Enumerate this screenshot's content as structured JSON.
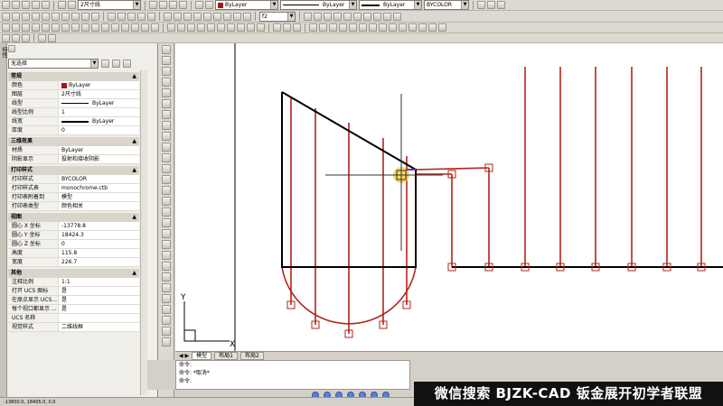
{
  "toolbar": {
    "layer_combo": "ByLayer",
    "linetype_combo": "ByLayer",
    "lineweight_combo": "ByLayer",
    "plotstyle_combo": "BYCOLOR",
    "textstyle_combo": "2尺寸线",
    "dimstyle_combo": "f2"
  },
  "palette": {
    "title": "特性",
    "selection": "无选择",
    "groups": [
      {
        "name": "常规",
        "rows": [
          {
            "k": "颜色",
            "v": "ByLayer",
            "kind": "swatch"
          },
          {
            "k": "图层",
            "v": "2尺寸线"
          },
          {
            "k": "线型",
            "v": "ByLayer",
            "kind": "thin"
          },
          {
            "k": "线型比例",
            "v": "1"
          },
          {
            "k": "线宽",
            "v": "ByLayer",
            "kind": "thick"
          },
          {
            "k": "厚度",
            "v": "0"
          }
        ]
      },
      {
        "name": "三维效果",
        "rows": [
          {
            "k": "材质",
            "v": "ByLayer"
          },
          {
            "k": "阴影显示",
            "v": "投射和接收阴影"
          }
        ]
      },
      {
        "name": "打印样式",
        "rows": [
          {
            "k": "打印样式",
            "v": "BYCOLOR"
          },
          {
            "k": "打印样式表",
            "v": "monochrome.ctb"
          },
          {
            "k": "打印表附着到",
            "v": "模型"
          },
          {
            "k": "打印表类型",
            "v": "颜色相关"
          }
        ]
      },
      {
        "name": "视图",
        "rows": [
          {
            "k": "圆心 X 坐标",
            "v": "-13778.8"
          },
          {
            "k": "圆心 Y 坐标",
            "v": "18424.3"
          },
          {
            "k": "圆心 Z 坐标",
            "v": "0"
          },
          {
            "k": "高度",
            "v": "115.8"
          },
          {
            "k": "宽度",
            "v": "226.7"
          }
        ]
      },
      {
        "name": "其他",
        "rows": [
          {
            "k": "注释比例",
            "v": "1:1"
          },
          {
            "k": "打开 UCS 图标",
            "v": "是"
          },
          {
            "k": "在原点显示 UCS...",
            "v": "是"
          },
          {
            "k": "每个视口都显示 ...",
            "v": "是"
          },
          {
            "k": "UCS 名称",
            "v": ""
          },
          {
            "k": "视觉样式",
            "v": "二维线框"
          }
        ]
      }
    ]
  },
  "tabs": [
    "模型",
    "布局1",
    "布局2"
  ],
  "command": {
    "line1": "命令:",
    "line2": "命令: *取消*",
    "line3": "命令:"
  },
  "status": {
    "coords": "-13800.0, 18405.0, 0.0"
  },
  "banner": "微信搜索 BJZK-CAD 钣金展开初学者联盟",
  "colors": {
    "black_outline": "#000000",
    "red_lines": "#b42318",
    "crosshair": "#333333",
    "highlight": "#f6d24a"
  }
}
